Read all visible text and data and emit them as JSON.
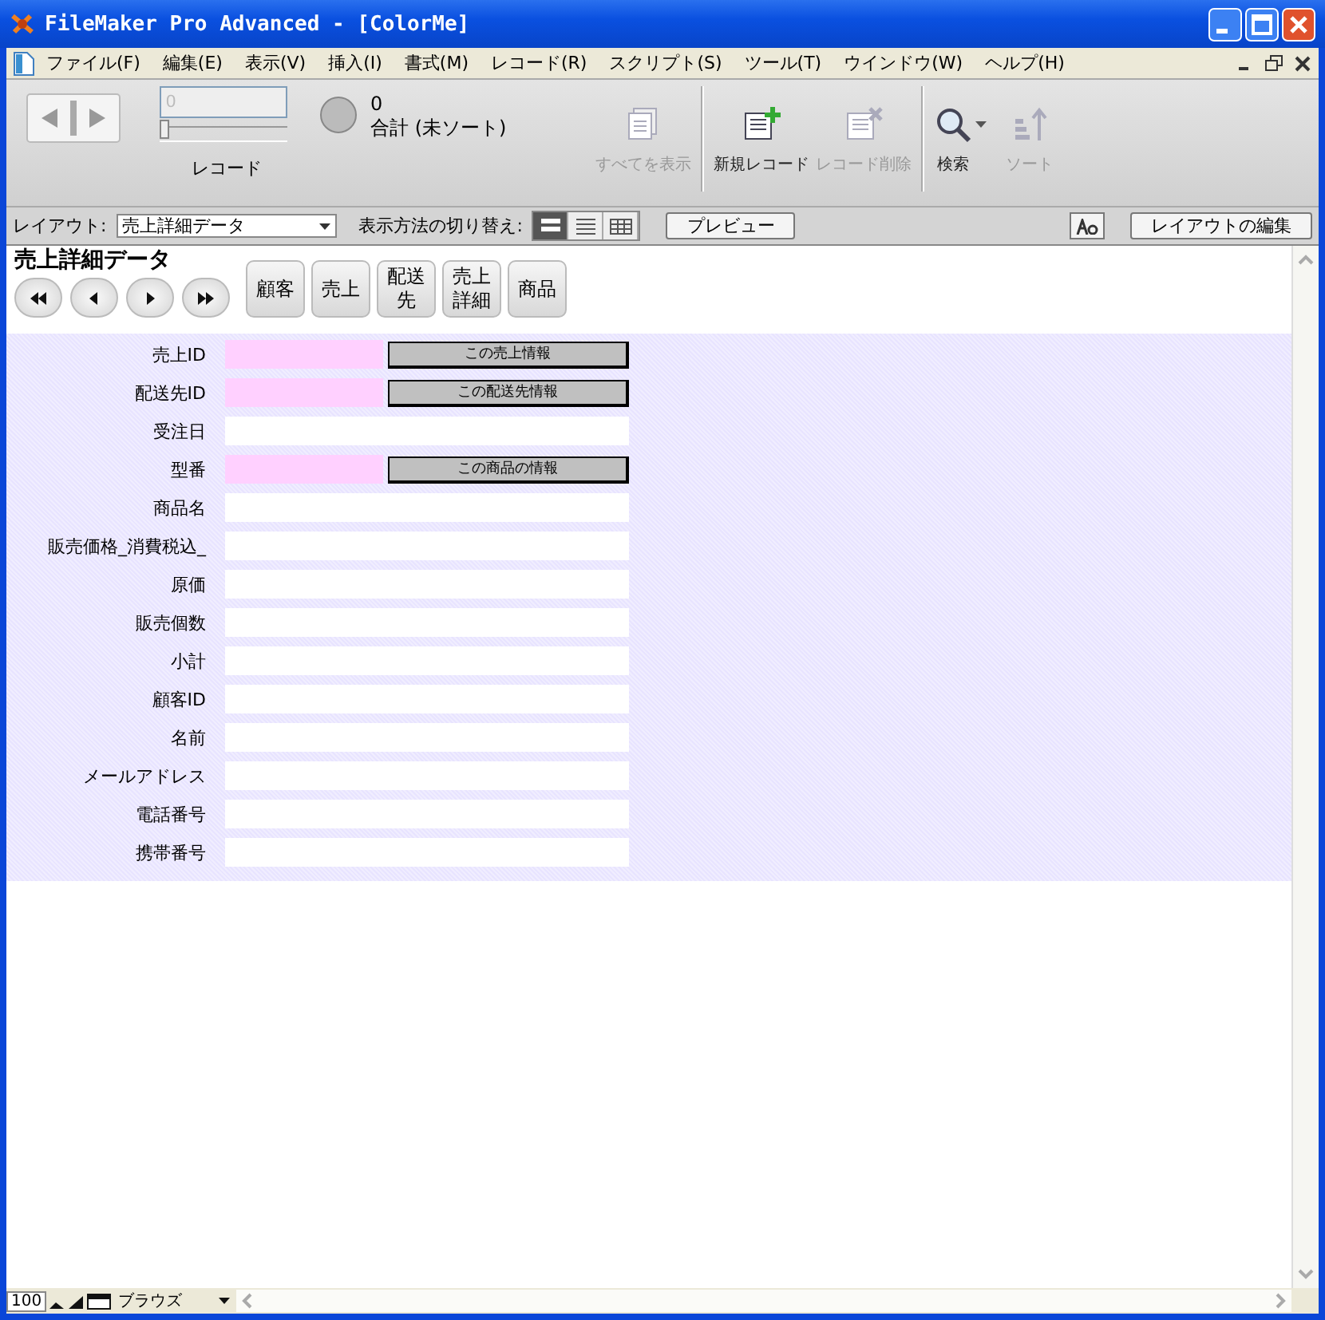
{
  "window": {
    "title": "FileMaker Pro Advanced - [ColorMe]"
  },
  "menu": [
    "ファイル(F)",
    "編集(E)",
    "表示(V)",
    "挿入(I)",
    "書式(M)",
    "レコード(R)",
    "スクリプト(S)",
    "ツール(T)",
    "ウインドウ(W)",
    "ヘルプ(H)"
  ],
  "toolbar": {
    "record_field": {
      "placeholder": "0"
    },
    "slider": {
      "level": 0
    },
    "record_label": "レコード",
    "found_count": "0",
    "total_label": "合計 (未ソート)",
    "tools": [
      {
        "kind": "show-all",
        "label": "すべてを表示",
        "disabled": true
      },
      {
        "kind": "new",
        "label": "新規レコード",
        "disabled": false
      },
      {
        "kind": "delete",
        "label": "レコード削除",
        "disabled": true
      },
      {
        "kind": "find",
        "label": "検索",
        "disabled": false
      },
      {
        "kind": "sort",
        "label": "ソート",
        "disabled": true
      }
    ]
  },
  "layout_bar": {
    "layout_label": "レイアウト:",
    "layout_value": "売上詳細データ",
    "view_label": "表示方法の切り替え:",
    "views": [
      {
        "kind": "form",
        "selected": true
      },
      {
        "kind": "list",
        "selected": false
      },
      {
        "kind": "table",
        "selected": false
      }
    ],
    "preview": "プレビュー",
    "edit_layout": "レイアウトの編集"
  },
  "form": {
    "title": "売上詳細データ",
    "nav": [
      {
        "kind": "first"
      },
      {
        "kind": "prev"
      },
      {
        "kind": "next"
      },
      {
        "kind": "last"
      }
    ],
    "tabs": [
      "顧客",
      "売上",
      "配送先",
      "売上詳細",
      "商品"
    ],
    "fields": [
      {
        "label": "売上ID",
        "kind": "key",
        "button": "この売上情報"
      },
      {
        "label": "配送先ID",
        "kind": "key",
        "button": "この配送先情報"
      },
      {
        "label": "受注日",
        "kind": "text"
      },
      {
        "label": "型番",
        "kind": "key",
        "button": "この商品の情報"
      },
      {
        "label": "商品名",
        "kind": "text"
      },
      {
        "label": "販売価格_消費税込_",
        "kind": "text"
      },
      {
        "label": "原価",
        "kind": "text"
      },
      {
        "label": "販売個数",
        "kind": "text"
      },
      {
        "label": "小計",
        "kind": "text"
      },
      {
        "label": "顧客ID",
        "kind": "text"
      },
      {
        "label": "名前",
        "kind": "text"
      },
      {
        "label": "メールアドレス",
        "kind": "text"
      },
      {
        "label": "電話番号",
        "kind": "text"
      },
      {
        "label": "携帯番号",
        "kind": "text"
      }
    ]
  },
  "status_bar": {
    "zoom": "100",
    "mode": "ブラウズ"
  }
}
